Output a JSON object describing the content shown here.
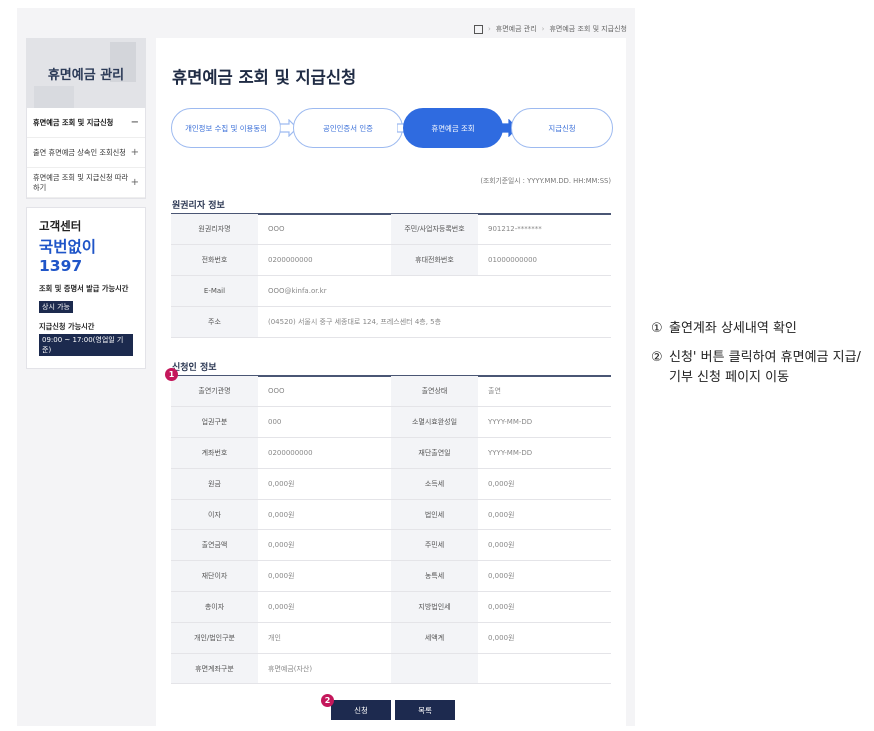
{
  "breadcrumb": {
    "items": [
      "휴면예금 관리",
      "휴면예금 조회 및 지급신청"
    ]
  },
  "sidebar": {
    "title": "휴면예금 관리",
    "items": [
      {
        "label": "휴면예금 조회 및 지급신청",
        "sign": "−"
      },
      {
        "label": "출연 휴면예금 상속인 조회신청",
        "sign": "+"
      },
      {
        "label": "휴면예금 조회 및 지급신청 따라하기",
        "sign": "+"
      }
    ]
  },
  "customer_center": {
    "title": "고객센터",
    "phone": "국번없이 1397",
    "inquiry_label": "조회 및 증명서 발급 가능시간",
    "inquiry_badge": "상시 가능",
    "payment_label": "지급신청 가능시간",
    "payment_badge": "09:00 ~ 17:00(영업일 기준)"
  },
  "main": {
    "title": "휴면예금 조회 및 지급신청",
    "steps": [
      "개인정보 수집 및 이용동의",
      "공인인증서 인증",
      "휴면예금 조회",
      "지급신청"
    ],
    "active_step": 2,
    "base_time": "(조회기준일시 : YYYY.MM.DD. HH:MM:SS)",
    "owner_section": {
      "title": "원권리자 정보",
      "rows": [
        [
          {
            "k": "원권리자명",
            "v": "OOO"
          },
          {
            "k": "주민/사업자등록번호",
            "v": "901212-*******"
          }
        ],
        [
          {
            "k": "전화번호",
            "v": "0200000000"
          },
          {
            "k": "휴대전화번호",
            "v": "01000000000"
          }
        ],
        [
          {
            "k": "E-Mail",
            "v": "OOO@kinfa.or.kr"
          }
        ],
        [
          {
            "k": "주소",
            "v": "(04520) 서울시 중구 세종대로 124, 프레스센터 4층, 5층"
          }
        ]
      ]
    },
    "applicant_section": {
      "title": "신청인 정보",
      "rows": [
        [
          {
            "k": "출연기관명",
            "v": "OOO"
          },
          {
            "k": "출연상태",
            "v": "출연"
          }
        ],
        [
          {
            "k": "업권구분",
            "v": "000"
          },
          {
            "k": "소멸시효완성일",
            "v": "YYYY-MM-DD"
          }
        ],
        [
          {
            "k": "계좌번호",
            "v": "0200000000"
          },
          {
            "k": "재단출연일",
            "v": "YYYY-MM-DD"
          }
        ],
        [
          {
            "k": "원금",
            "v": "0,000원"
          },
          {
            "k": "소득세",
            "v": "0,000원"
          }
        ],
        [
          {
            "k": "이자",
            "v": "0,000원"
          },
          {
            "k": "법인세",
            "v": "0,000원"
          }
        ],
        [
          {
            "k": "출연금액",
            "v": "0,000원"
          },
          {
            "k": "주민세",
            "v": "0,000원"
          }
        ],
        [
          {
            "k": "재단이자",
            "v": "0,000원"
          },
          {
            "k": "농특세",
            "v": "0,000원"
          }
        ],
        [
          {
            "k": "총이자",
            "v": "0,000원"
          },
          {
            "k": "지방법인세",
            "v": "0,000원"
          }
        ],
        [
          {
            "k": "개인/법인구분",
            "v": "개인"
          },
          {
            "k": "세액계",
            "v": "0,000원"
          }
        ],
        [
          {
            "k": "휴면계좌구분",
            "v": "휴면예금(자산)"
          },
          {
            "k": "",
            "v": ""
          }
        ]
      ]
    },
    "buttons": {
      "apply": "신청",
      "list": "목록"
    },
    "markers": [
      "1",
      "2"
    ]
  },
  "notes": [
    {
      "num": "①",
      "text": "출연계좌 상세내역 확인"
    },
    {
      "num": "②",
      "text": "신청' 버튼 클릭하여 휴면예금 지급/기부 신청 페이지 이동"
    }
  ],
  "colors": {
    "accent": "#2f6be0",
    "navy": "#1d2a4f",
    "marker": "#c4175b"
  }
}
